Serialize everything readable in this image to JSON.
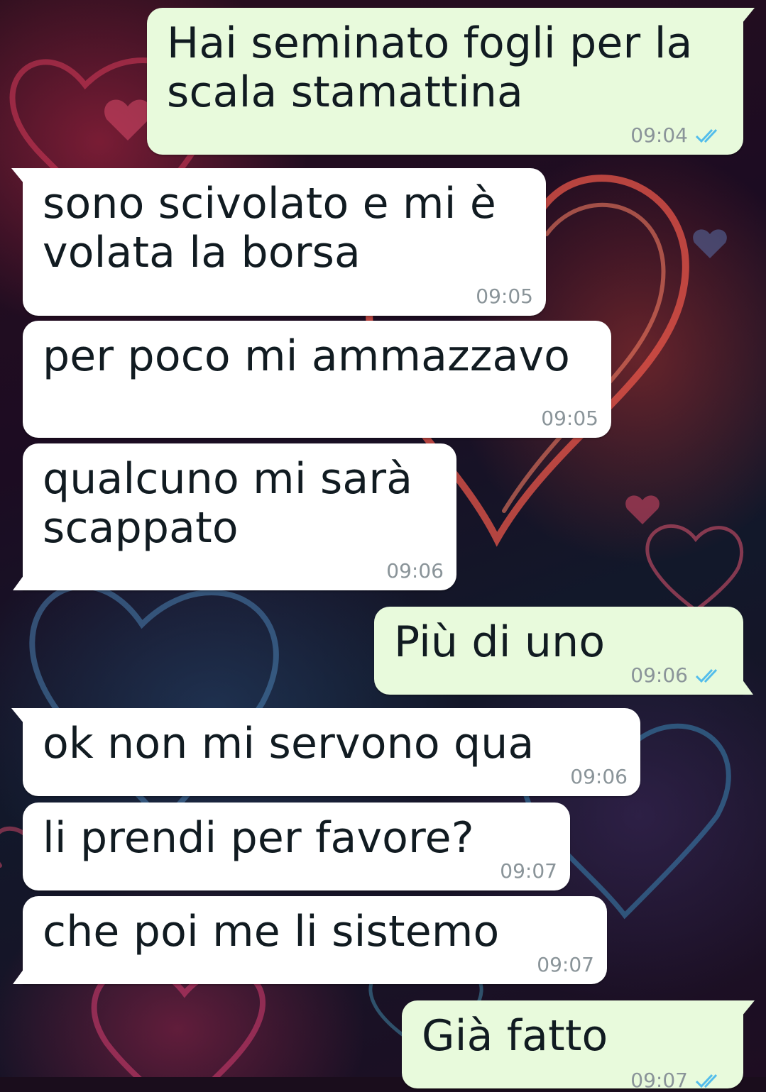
{
  "colors": {
    "incoming_bubble": "#ffffff",
    "outgoing_bubble": "#e8fadc",
    "timestamp": "#8a9499",
    "read_check": "#53bdeb"
  },
  "messages": [
    {
      "direction": "out",
      "text": "Hai seminato fogli per la\nscala stamattina",
      "time": "09:04",
      "status_icon": "double-check-icon"
    },
    {
      "direction": "in",
      "text": "sono scivolato e mi è\nvolata la borsa",
      "time": "09:05"
    },
    {
      "direction": "in",
      "text": "per poco mi ammazzavo",
      "time": "09:05"
    },
    {
      "direction": "in",
      "text": "qualcuno mi sarà\nscappato",
      "time": "09:06"
    },
    {
      "direction": "out",
      "text": "Più di uno",
      "time": "09:06",
      "status_icon": "double-check-icon"
    },
    {
      "direction": "in",
      "text": "ok non mi servono qua",
      "time": "09:06"
    },
    {
      "direction": "in",
      "text": "li prendi per favore?",
      "time": "09:07"
    },
    {
      "direction": "in",
      "text": "che poi me li sistemo",
      "time": "09:07"
    },
    {
      "direction": "out",
      "text": "Già fatto",
      "time": "09:07",
      "status_icon": "double-check-icon"
    }
  ]
}
